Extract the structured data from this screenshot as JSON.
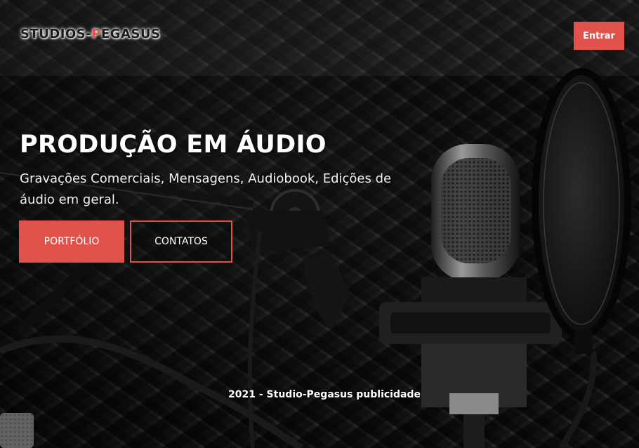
{
  "header": {
    "logo_part1": "STUDIOS-",
    "logo_accent": "P",
    "logo_part2": "EGASUS",
    "login_label": "Entrar"
  },
  "hero": {
    "title": "PRODUÇÃO EM ÁUDIO",
    "subtitle": "Gravações Comerciais, Mensagens, Audiobook, Edições de áudio em geral.",
    "portfolio_label": "PORTFÓLIO",
    "contacts_label": "CONTATOS"
  },
  "footer": {
    "text": "2021 - Studio-Pegasus publicidade"
  },
  "colors": {
    "accent": "#e0524b",
    "background": "#0b0b0b",
    "text": "#ffffff"
  },
  "icons": {
    "background_image": "studio-microphone-image"
  }
}
